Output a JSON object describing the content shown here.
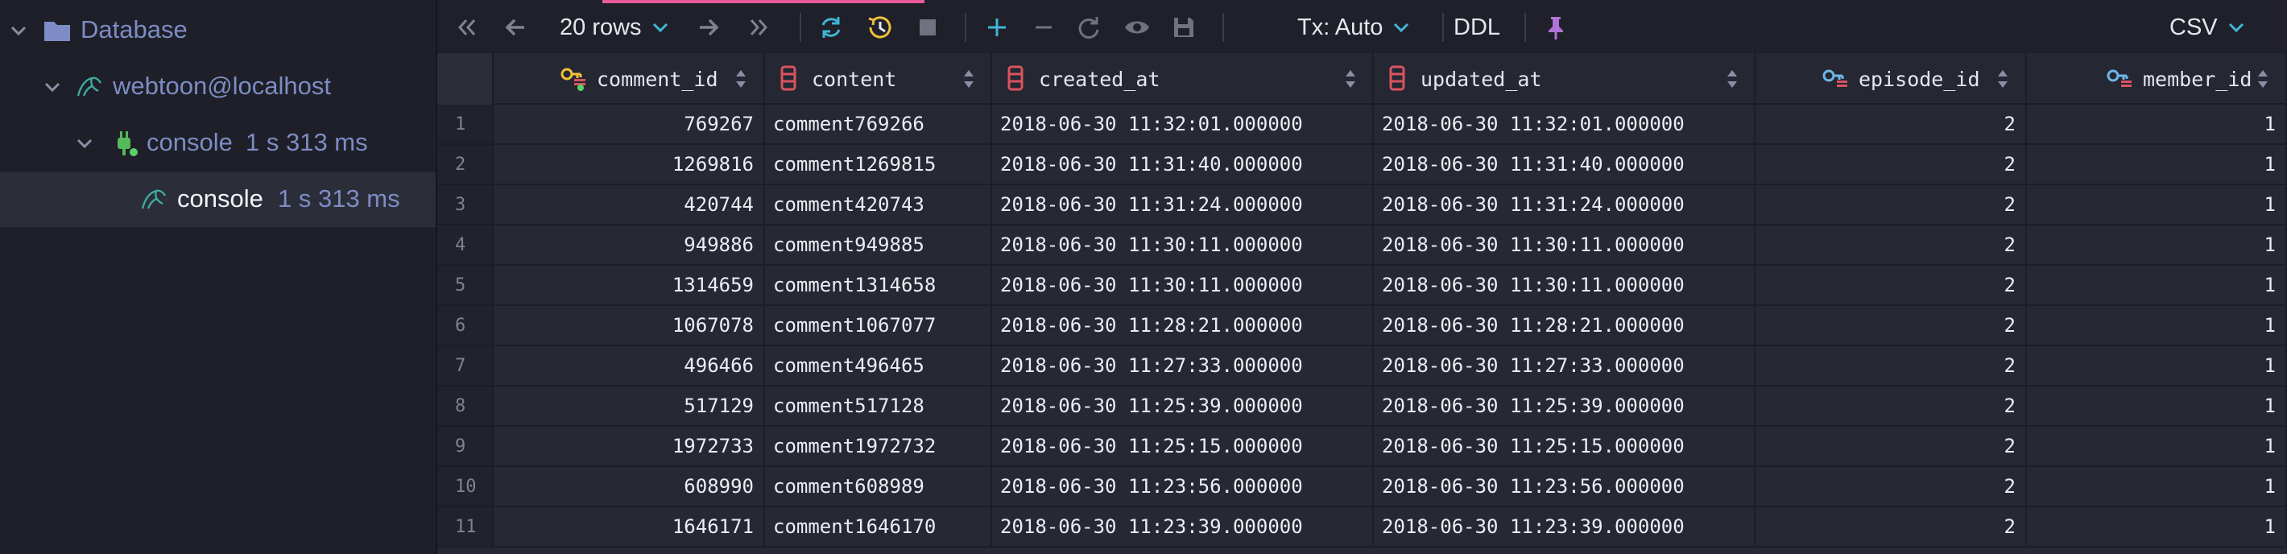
{
  "sidebar": {
    "items": [
      {
        "label": "Database",
        "icon": "folder-icon"
      },
      {
        "label": "webtoon@localhost",
        "icon": "mysql-icon"
      },
      {
        "label": "console",
        "duration": "1 s 313 ms",
        "icon": "plug-icon"
      },
      {
        "label": "console",
        "duration": "1 s 313 ms",
        "icon": "mysql-icon"
      }
    ]
  },
  "toolbar": {
    "rows_label": "20 rows",
    "tx_label": "Tx: Auto",
    "ddl_label": "DDL",
    "export_label": "CSV"
  },
  "colors": {
    "sidebar_text": "#7d8cc4",
    "accent_plus": "#3fb6d6",
    "refresh": "#3fb6d6",
    "history": "#f0c13c",
    "pin": "#b073d8",
    "pk_key": "#f0c13c",
    "fk_key": "#6fb6e8",
    "column_icon": "#d9545f"
  },
  "table": {
    "columns": [
      {
        "name": "comment_id",
        "icon": "primary-key-icon",
        "align": "right"
      },
      {
        "name": "content",
        "icon": "column-icon",
        "align": "left"
      },
      {
        "name": "created_at",
        "icon": "column-icon",
        "align": "left"
      },
      {
        "name": "updated_at",
        "icon": "column-icon",
        "align": "left"
      },
      {
        "name": "episode_id",
        "icon": "foreign-key-icon",
        "align": "right"
      },
      {
        "name": "member_id",
        "icon": "foreign-key-icon",
        "align": "right"
      }
    ],
    "rows": [
      [
        "1",
        "769267",
        "comment769266",
        "2018-06-30 11:32:01.000000",
        "2018-06-30 11:32:01.000000",
        "2",
        "1"
      ],
      [
        "2",
        "1269816",
        "comment1269815",
        "2018-06-30 11:31:40.000000",
        "2018-06-30 11:31:40.000000",
        "2",
        "1"
      ],
      [
        "3",
        "420744",
        "comment420743",
        "2018-06-30 11:31:24.000000",
        "2018-06-30 11:31:24.000000",
        "2",
        "1"
      ],
      [
        "4",
        "949886",
        "comment949885",
        "2018-06-30 11:30:11.000000",
        "2018-06-30 11:30:11.000000",
        "2",
        "1"
      ],
      [
        "5",
        "1314659",
        "comment1314658",
        "2018-06-30 11:30:11.000000",
        "2018-06-30 11:30:11.000000",
        "2",
        "1"
      ],
      [
        "6",
        "1067078",
        "comment1067077",
        "2018-06-30 11:28:21.000000",
        "2018-06-30 11:28:21.000000",
        "2",
        "1"
      ],
      [
        "7",
        "496466",
        "comment496465",
        "2018-06-30 11:27:33.000000",
        "2018-06-30 11:27:33.000000",
        "2",
        "1"
      ],
      [
        "8",
        "517129",
        "comment517128",
        "2018-06-30 11:25:39.000000",
        "2018-06-30 11:25:39.000000",
        "2",
        "1"
      ],
      [
        "9",
        "1972733",
        "comment1972732",
        "2018-06-30 11:25:15.000000",
        "2018-06-30 11:25:15.000000",
        "2",
        "1"
      ],
      [
        "10",
        "608990",
        "comment608989",
        "2018-06-30 11:23:56.000000",
        "2018-06-30 11:23:56.000000",
        "2",
        "1"
      ],
      [
        "11",
        "1646171",
        "comment1646170",
        "2018-06-30 11:23:39.000000",
        "2018-06-30 11:23:39.000000",
        "2",
        "1"
      ]
    ]
  }
}
